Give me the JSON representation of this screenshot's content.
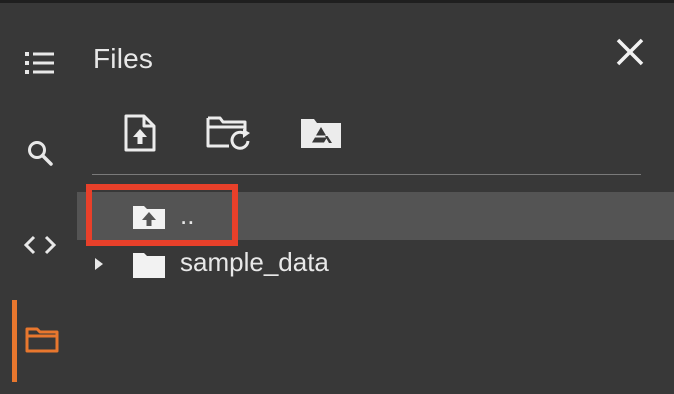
{
  "panel": {
    "title": "Files"
  },
  "rail": {
    "items": [
      {
        "icon": "table-of-contents-icon"
      },
      {
        "icon": "search-icon"
      },
      {
        "icon": "code-snippets-icon"
      },
      {
        "icon": "folder-icon",
        "active": true
      }
    ]
  },
  "toolbar": {
    "buttons": [
      {
        "icon": "upload-file-icon"
      },
      {
        "icon": "refresh-folder-icon"
      },
      {
        "icon": "mount-drive-icon"
      }
    ]
  },
  "tree": {
    "rows": [
      {
        "label": "..",
        "icon": "parent-folder-icon",
        "selected": true
      },
      {
        "label": "sample_data",
        "icon": "folder-icon",
        "expandable": true
      }
    ]
  },
  "colors": {
    "background": "#383838",
    "selected_row": "#545454",
    "accent": "#e8772e",
    "highlight": "#e8402a",
    "text": "#e8e8e8"
  }
}
